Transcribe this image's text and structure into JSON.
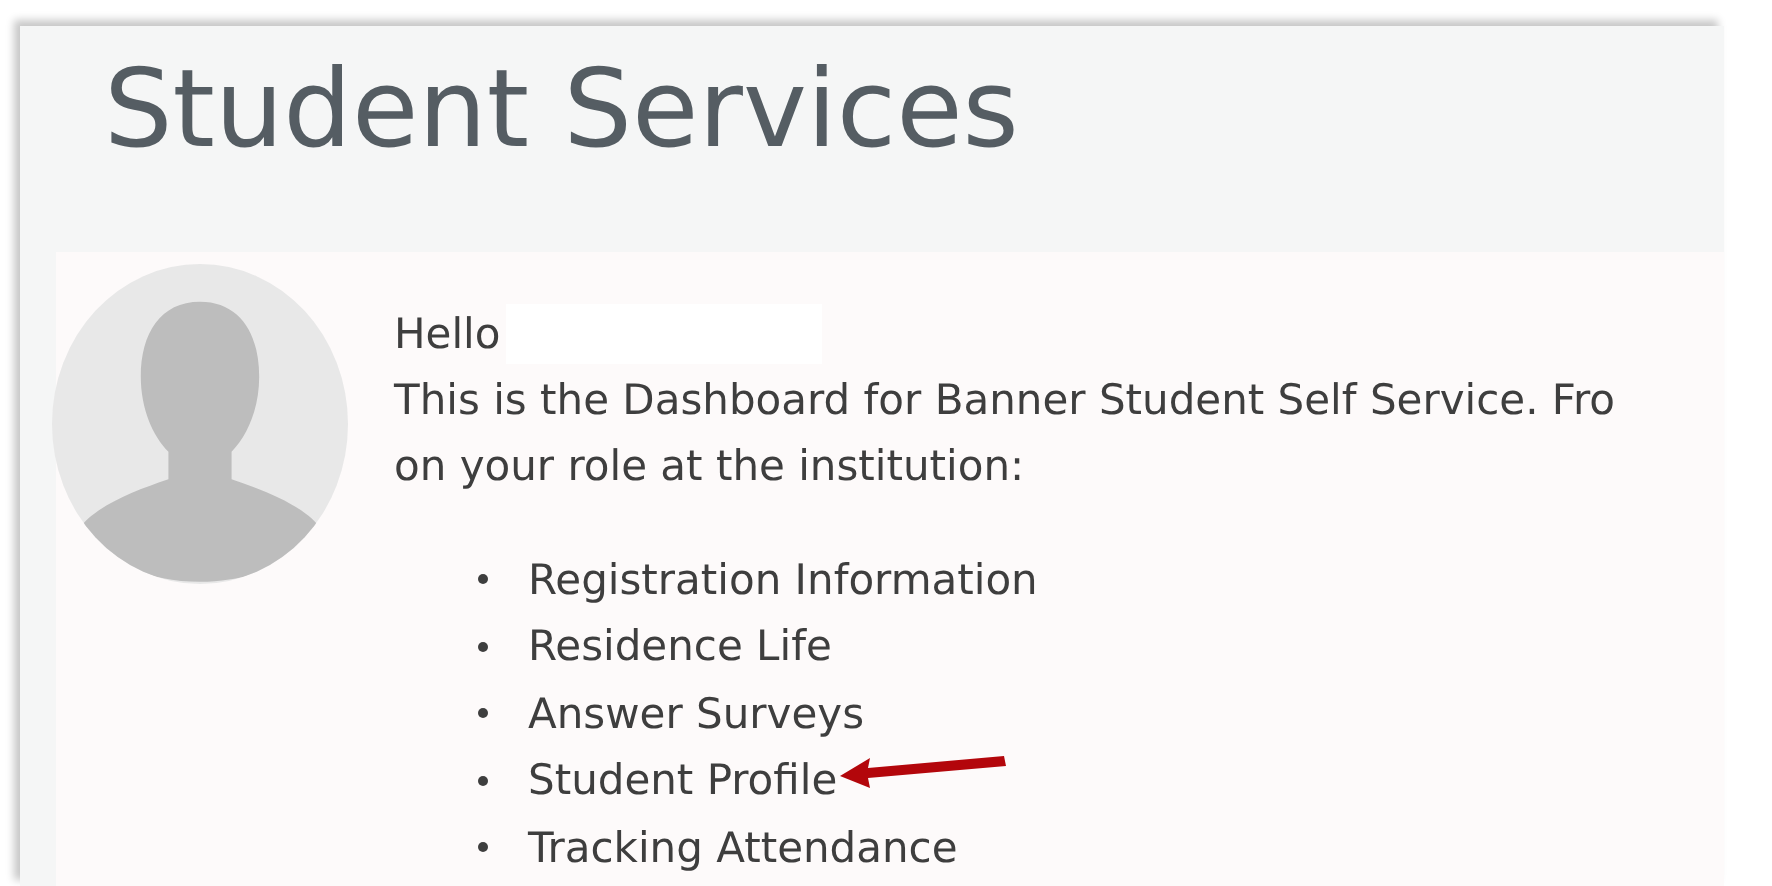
{
  "page": {
    "title": "Student Services"
  },
  "welcome": {
    "greeting": "Hello",
    "name_redacted": true,
    "intro_lines": [
      "This is the Dashboard for Banner Student Self Service. Fro",
      "on your role at the institution:"
    ]
  },
  "items": [
    {
      "label": "Registration Information",
      "marked": false
    },
    {
      "label": "Residence Life",
      "marked": false
    },
    {
      "label": "Answer Surveys",
      "marked": false
    },
    {
      "label": "Student Profile",
      "marked": true
    },
    {
      "label": "Tracking Attendance",
      "marked": false
    }
  ]
}
